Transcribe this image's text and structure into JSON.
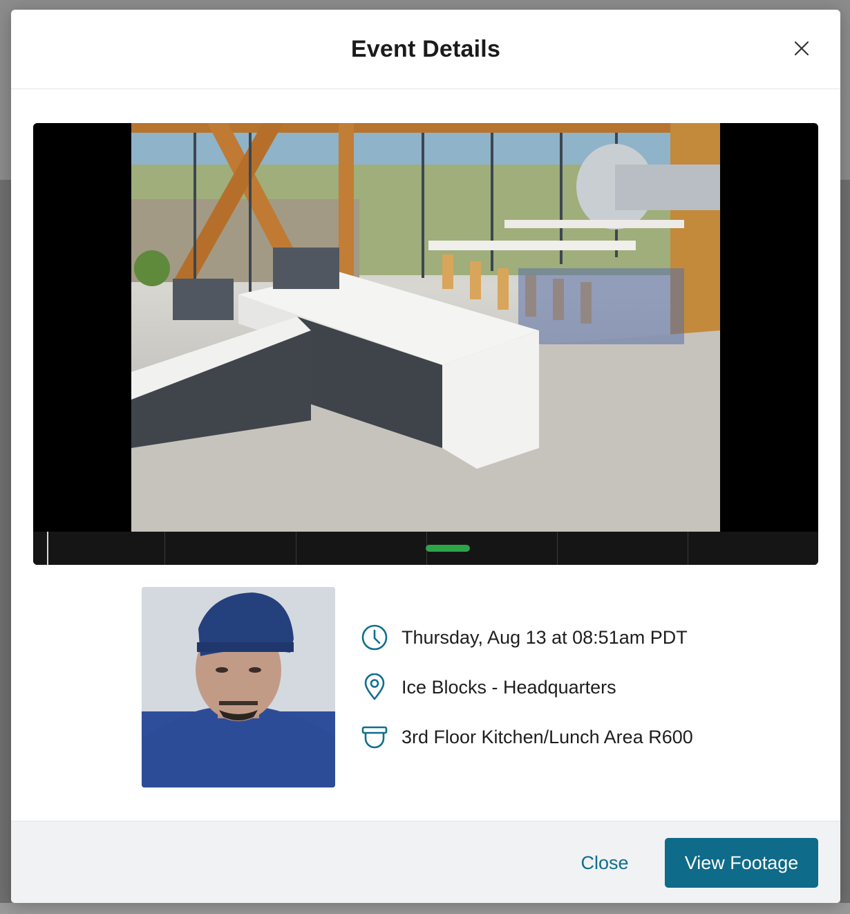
{
  "modal": {
    "title": "Event Details"
  },
  "player": {
    "timeline_marker_color": "#2fa34a"
  },
  "event": {
    "datetime": "Thursday, Aug 13 at 08:51am PDT",
    "location": "Ice Blocks - Headquarters",
    "camera": "3rd Floor Kitchen/Lunch Area R600"
  },
  "icons": {
    "time": "clock-icon",
    "location": "map-pin-icon",
    "camera": "dome-camera-icon",
    "close": "close-icon"
  },
  "footer": {
    "close_label": "Close",
    "view_footage_label": "View Footage"
  },
  "colors": {
    "accent": "#0e6b89",
    "footer_bg": "#f1f2f4"
  }
}
